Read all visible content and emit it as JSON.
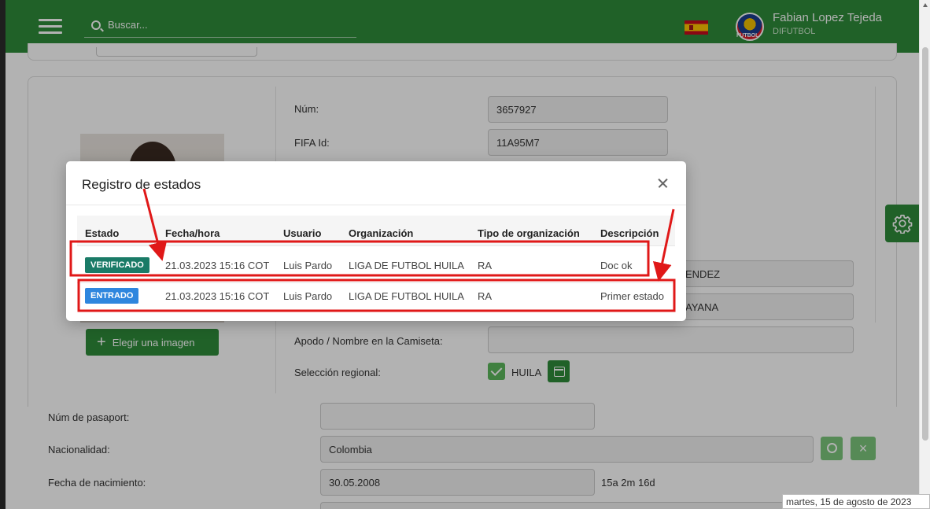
{
  "header": {
    "search_placeholder": "Buscar...",
    "user_name": "Fabian Lopez Tejeda",
    "user_org": "DIFUTBOL",
    "avatar_label": "FUTBOL"
  },
  "player_form": {
    "num_label": "Núm:",
    "num_value": "3657927",
    "fifa_label": "FIFA Id:",
    "fifa_value": "11A95M7",
    "surname_partial": "ENDEZ",
    "city_partial": "AYANA",
    "nickname_label": "Apodo / Nombre en la Camiseta:",
    "nickname_value": "",
    "regional_label": "Selección regional:",
    "regional_value": "HUILA",
    "choose_image_label": "Elegir una imagen",
    "passport_label": "Núm de pasaport:",
    "passport_value": "",
    "nationality_label": "Nacionalidad:",
    "nationality_value": "Colombia",
    "birthdate_label": "Fecha de nacimiento:",
    "birthdate_value": "30.05.2008",
    "age_value": "15a 2m 16d"
  },
  "modal": {
    "title": "Registro de estados",
    "columns": [
      "Estado",
      "Fecha/hora",
      "Usuario",
      "Organización",
      "Tipo de organización",
      "Descripción"
    ],
    "rows": [
      {
        "estado": "VERIFICADO",
        "estado_color": "#1a7b67",
        "fecha": "21.03.2023 15:16 COT",
        "usuario": "Luis Pardo",
        "organizacion": "LIGA DE FUTBOL HUILA",
        "tipo": "RA",
        "descripcion": "Doc ok"
      },
      {
        "estado": "ENTRADO",
        "estado_color": "#2e86de",
        "fecha": "21.03.2023 15:16 COT",
        "usuario": "Luis Pardo",
        "organizacion": "LIGA DE FUTBOL HUILA",
        "tipo": "RA",
        "descripcion": "Primer estado"
      }
    ]
  },
  "footer_date": "martes, 15 de agosto de 2023",
  "colors": {
    "header_green": "#2e8b3a",
    "annotation_red": "#e01818"
  }
}
